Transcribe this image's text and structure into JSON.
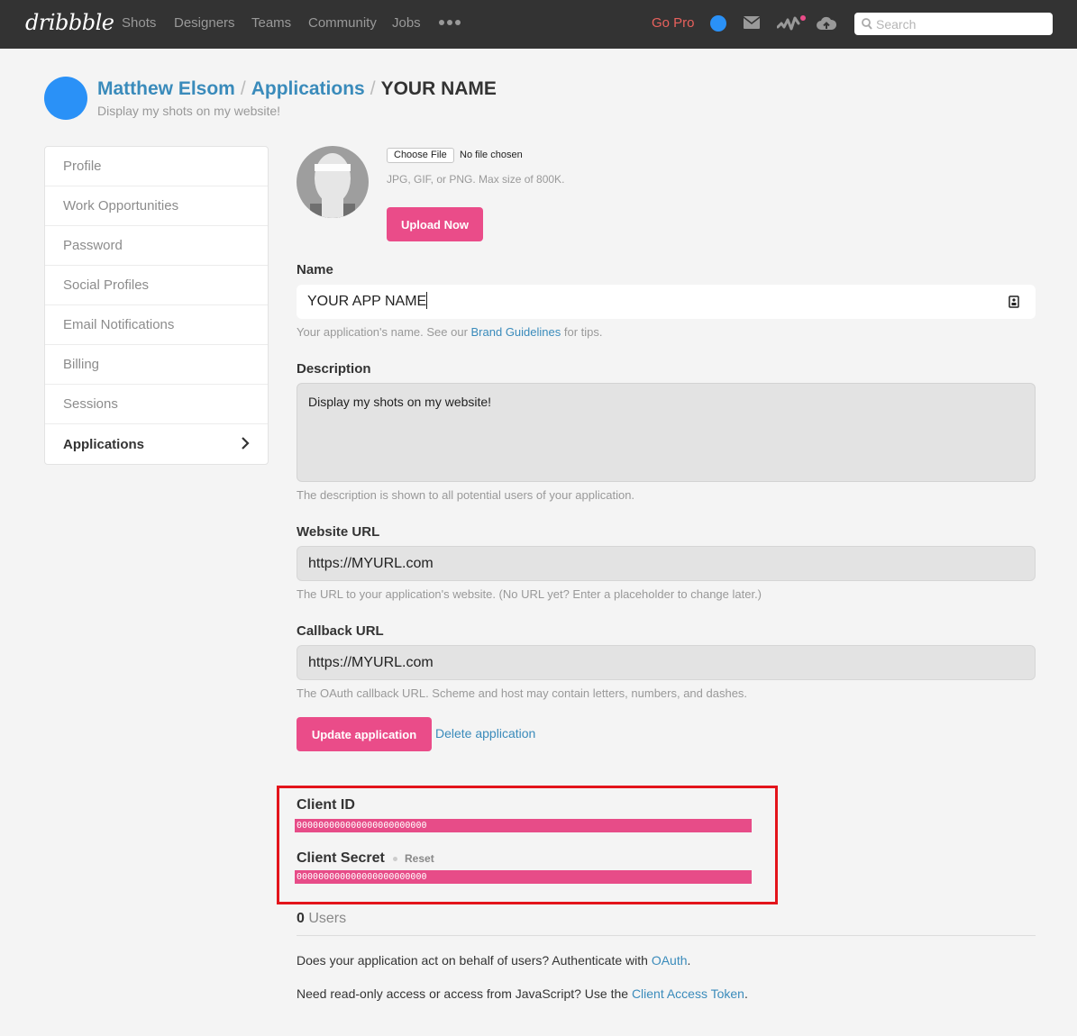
{
  "nav": {
    "logo": "dribbble",
    "items": [
      "Shots",
      "Designers",
      "Teams",
      "Community",
      "Jobs"
    ],
    "more_icon": "ellipsis-icon",
    "go_pro": "Go Pro",
    "icons": [
      "avatar",
      "mail-icon",
      "activity-icon",
      "upload-cloud-icon"
    ],
    "search_placeholder": "Search",
    "colors": {
      "bg": "#333333",
      "go_pro": "#e8615d",
      "notification": "#ea4c89",
      "avatar": "#2a91f7"
    }
  },
  "header": {
    "breadcrumb": [
      "Matthew Elsom",
      "Applications",
      "YOUR NAME"
    ],
    "separator": "/",
    "subtitle": "Display my shots on my website!"
  },
  "sidebar": {
    "items": [
      {
        "label": "Profile"
      },
      {
        "label": "Work Opportunities"
      },
      {
        "label": "Password"
      },
      {
        "label": "Social Profiles"
      },
      {
        "label": "Email Notifications"
      },
      {
        "label": "Billing"
      },
      {
        "label": "Sessions"
      },
      {
        "label": "Applications",
        "active": true
      }
    ]
  },
  "upload": {
    "choose_file": "Choose File",
    "no_file": "No file chosen",
    "hint": "JPG, GIF, or PNG. Max size of 800K.",
    "button": "Upload Now"
  },
  "form": {
    "name": {
      "label": "Name",
      "value": "YOUR APP NAME",
      "help_prefix": "Your application's name. See our ",
      "help_link": "Brand Guidelines",
      "help_suffix": " for tips."
    },
    "description": {
      "label": "Description",
      "value": "Display my shots on my website!",
      "help": "The description is shown to all potential users of your application."
    },
    "website_url": {
      "label": "Website URL",
      "value": "https://MYURL.com",
      "help": "The URL to your application's website. (No URL yet? Enter a placeholder to change later.)"
    },
    "callback_url": {
      "label": "Callback URL",
      "value": "https://MYURL.com",
      "help": "The OAuth callback URL. Scheme and host may contain letters, numbers, and dashes."
    },
    "update_button": "Update application",
    "delete_link": "Delete application"
  },
  "credentials": {
    "client_id_label": "Client ID",
    "client_id": "000000000000000000000000",
    "client_secret_label": "Client Secret",
    "reset": "Reset",
    "client_secret": "000000000000000000000000",
    "highlight_color": "#e3141b"
  },
  "users": {
    "count": "0",
    "label": " Users"
  },
  "info": {
    "oauth_prefix": "Does your application act on behalf of users? Authenticate with ",
    "oauth_link": "OAuth",
    "oauth_suffix": ".",
    "token_prefix": "Need read-only access or access from JavaScript? Use the ",
    "token_link": "Client Access Token",
    "token_suffix": "."
  }
}
